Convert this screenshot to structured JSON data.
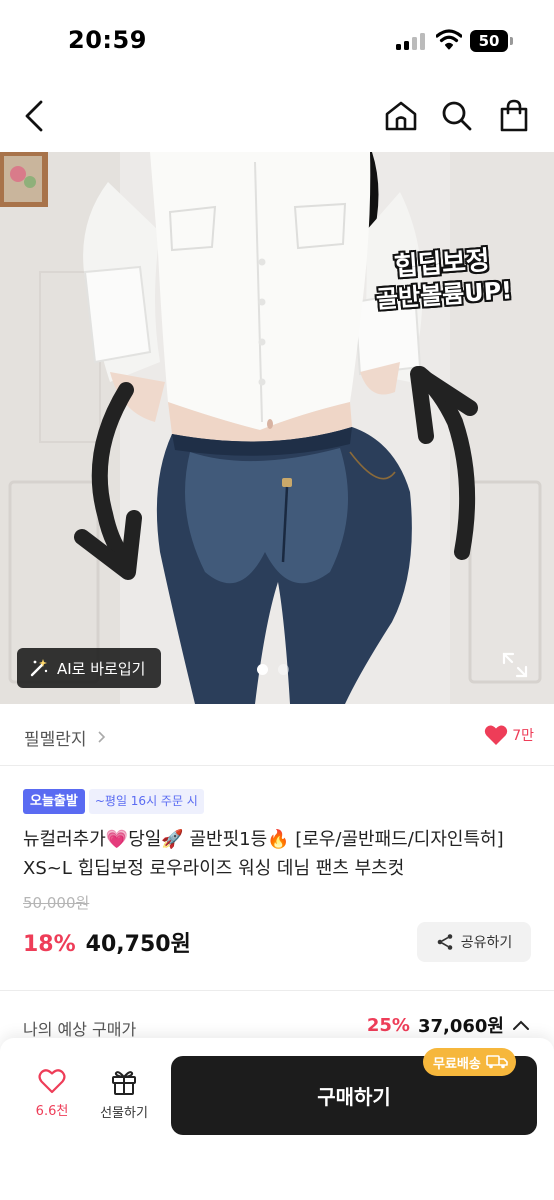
{
  "status_bar": {
    "time": "20:59",
    "battery": "50"
  },
  "header": {
    "back_icon": "chevron-left-icon",
    "home_icon": "home-icon",
    "search_icon": "search-icon",
    "cart_icon": "shopping-bag-icon"
  },
  "hero": {
    "overlay_text": [
      "힙딥보정",
      "골반볼륨UP!"
    ],
    "ai_button": "AI로 바로입기",
    "total_slides": 2,
    "current_slide": 1
  },
  "brand": {
    "name": "필멜란지",
    "like_count": "7만"
  },
  "product": {
    "tag_primary": "오늘출발",
    "tag_secondary": "~평일 16시 주문 시",
    "title": "뉴컬러추가💗당일🚀 골반핏1등🔥 [로우/골반패드/디자인특허] XS~L 힙딥보정 로우라이즈 워싱 데님 팬츠 부츠컷",
    "original_price": "50,000원",
    "discount": "18%",
    "price": "40,750원",
    "share_label": "공유하기"
  },
  "estimate": {
    "label": "나의 예상 구매가",
    "discount": "25%",
    "price": "37,060원"
  },
  "bottom_bar": {
    "wish_count": "6.6천",
    "gift_label": "선물하기",
    "buy_label": "구매하기",
    "shipping_badge": "무료배송"
  },
  "colors": {
    "accent_pink": "#ee3d58",
    "tag_blue": "#5a6bf2",
    "buy_dark": "#1c1c1c",
    "badge_orange": "#f6b73c"
  }
}
